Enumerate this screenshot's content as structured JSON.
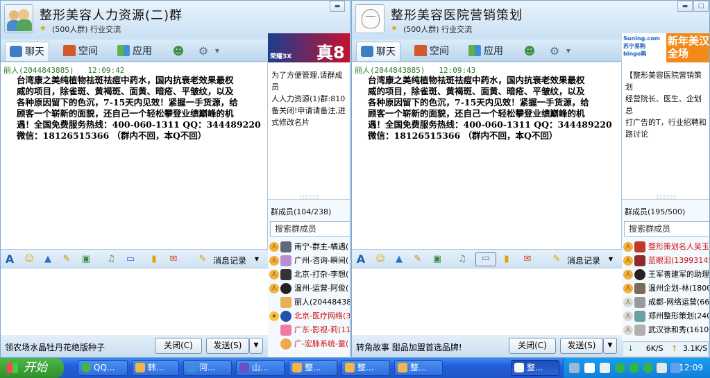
{
  "windows": [
    {
      "title": "整形美容人力资源(二)群",
      "subtitle": "(500人群) 行业交流",
      "tabs": [
        "聊天",
        "空间",
        "应用"
      ],
      "ad_text": "真8",
      "ad_small": "荣耀3X",
      "message": {
        "sender": "丽人(2044843885)",
        "time": "12:09:42",
        "lines": [
          "台湾康之美纯植物祛斑祛痘中药水，国内抗衰老效果最权",
          "威的项目，除雀斑、黄褐斑、面黄、暗疮、平皱纹，以及",
          "各种原因留下的色沉，7-15天内见效！紧握一手货源，给",
          "顾客一个崭新的面貌，还自己一个轻松攀登业绩巅峰的机",
          "遇！全国免费服务热线：400-060-1311 QQ：344489220",
          "微信：18126515366 （群内不回，本Q不回）"
        ]
      },
      "notice_lines": [
        "为了方便管理,请群成员",
        "人人力资源(1)群:810",
        "备关闭!申请请备注,进",
        "式修改名片"
      ],
      "member_count": "群成员(104/238)",
      "search_placeholder": "搜索群成员",
      "members": [
        {
          "name": "南宁-群主-橘遇(",
          "red": false
        },
        {
          "name": "广州-咨询-瞬间(",
          "red": false
        },
        {
          "name": "北京-打杂-李想(",
          "red": false
        },
        {
          "name": "温州-运营-阿俊(",
          "red": false
        },
        {
          "name": "丽人(2044843885",
          "red": false
        },
        {
          "name": "北京-医疗网络(3",
          "red": true
        },
        {
          "name": "广东-影视-莉(11",
          "red": true
        },
        {
          "name": "广-宏脉系统-童(",
          "red": true
        }
      ],
      "history_label": "消息记录",
      "bottom_text": "领农场水晶牡丹花绝版种子",
      "close_label": "关闭(C)",
      "send_label": "发送(S)"
    },
    {
      "title": "整形美容医院营销策划",
      "subtitle": "(500人群) 行业交流",
      "tabs": [
        "聊天",
        "空间",
        "应用"
      ],
      "ad_text": "新年美汉全场",
      "ad_small": "Suning.com 苏宁易购 bingo购",
      "message": {
        "sender": "丽人(2044843885)",
        "time": "12:09:43",
        "lines": [
          "台湾康之美纯植物祛斑祛痘中药水，国内抗衰老效果最权",
          "威的项目，除雀斑、黄褐斑、面黄、暗疮、平皱纹，以及",
          "各种原因留下的色沉，7-15天内见效！紧握一手货源，给",
          "顾客一个崭新的面貌，还自己一个轻松攀登业绩巅峰的机",
          "遇！全国免费服务热线：400-060-1311 QQ：344489220",
          "微信：18126515366 （群内不回，本Q不回）"
        ]
      },
      "notice_lines": [
        "【整形美容医院营销策划",
        "经营院长、医生、企划总",
        "打广告的T，行业招聘和",
        "路讨论"
      ],
      "member_count": "群成员(195/500)",
      "search_placeholder": "搜索群成员",
      "members": [
        {
          "name": "整形策划名人吴玉",
          "red": true
        },
        {
          "name": "蓝眼泪(139931455",
          "red": true
        },
        {
          "name": "王军善建军的助理",
          "red": false
        },
        {
          "name": "温州企划-林(1800",
          "red": false
        },
        {
          "name": "成都-网络运营(66",
          "red": false
        },
        {
          "name": "郑州整形策划(240",
          "red": false
        },
        {
          "name": "武汉徐和秀(16106",
          "red": false
        }
      ],
      "history_label": "消息记录",
      "bottom_text": "转角故事 甜品加盟首选品牌!",
      "close_label": "关闭(C)",
      "send_label": "发送(S)",
      "speed_down": "6K/S",
      "speed_up": "3.1K/S"
    }
  ],
  "taskbar": {
    "start_label": "开始",
    "tasks": [
      "QQ...",
      "韩...",
      "河...",
      "山...",
      "整...",
      "整...",
      "整...",
      "整..."
    ],
    "clock": "12:09"
  },
  "colors": {
    "member_red": "#d01010",
    "sender_green": "#2a7a2a",
    "taskbar_blue": "#245edb"
  }
}
